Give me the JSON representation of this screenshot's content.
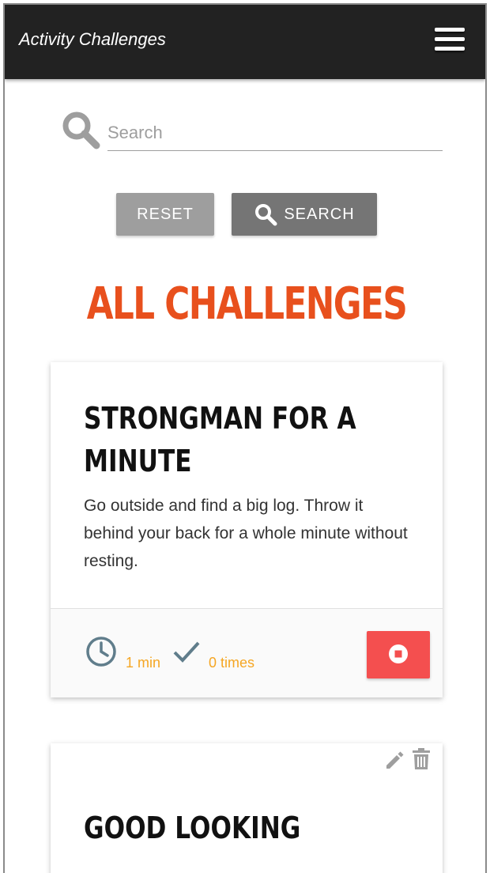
{
  "navbar": {
    "brand": "Activity Challenges",
    "menu_icon": "hamburger-menu-icon"
  },
  "search": {
    "placeholder": "Search",
    "value": "",
    "icon": "search-icon"
  },
  "buttons": {
    "reset_label": "RESET",
    "search_label": "SEARCH"
  },
  "page_heading": "ALL CHALLENGES",
  "challenges": [
    {
      "title": "STRONGMAN FOR A MINUTE",
      "description": "Go outside and find a big log. Throw it behind your back for a whole minute without resting.",
      "duration": "1 min",
      "completed": "0 times",
      "action_icon": "stop-icon"
    },
    {
      "title": "GOOD LOOKING",
      "edit_icon": "pencil-icon",
      "delete_icon": "trash-icon"
    }
  ],
  "colors": {
    "accent": "#e8501d",
    "meta": "#f5a623",
    "stop": "#f44f4f",
    "navbar": "#222222"
  }
}
